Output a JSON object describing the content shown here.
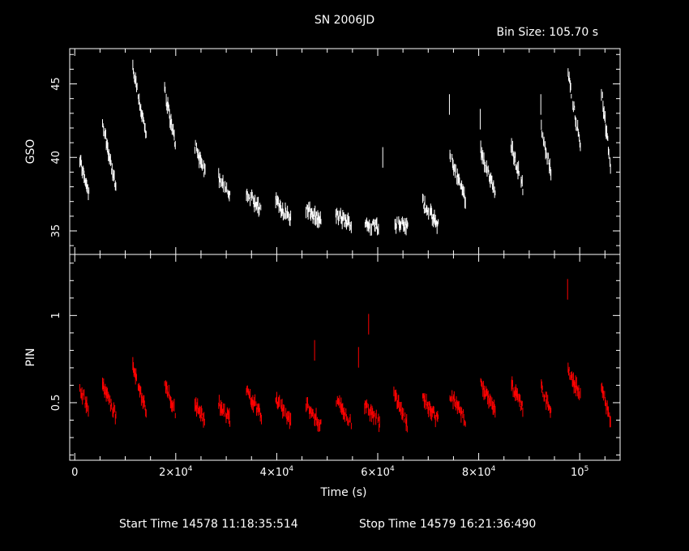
{
  "header": {
    "title": "SN 2006JD",
    "bin_size": "Bin Size: 105.70 s"
  },
  "footer": {
    "start_time": "Start Time 14578 11:18:35:514",
    "stop_time": "Stop Time 14579 16:21:36:490"
  },
  "colors": {
    "background": "#000000",
    "axes": "#ffffff",
    "gso_series": "#ffffff",
    "pin_series": "#ff0000"
  },
  "chart_data": [
    {
      "type": "scatter",
      "panel": "top",
      "ylabel": "GSO",
      "xlim": [
        -1000,
        108000
      ],
      "ylim": [
        33.4,
        47.4
      ],
      "yticks": [
        35,
        40,
        45
      ],
      "ytick_labels": [
        "35",
        "40",
        "45"
      ],
      "series": [
        {
          "segments": [
            {
              "x": [
                1000,
                2800
              ],
              "y": [
                39.8,
                37.6
              ]
            },
            {
              "x": [
                5500,
                8200
              ],
              "y": [
                42.4,
                37.8
              ]
            },
            {
              "x": [
                11500,
                14200
              ],
              "y": [
                46.0,
                41.4
              ]
            },
            {
              "x": [
                17800,
                20000
              ],
              "y": [
                44.5,
                40.8
              ]
            },
            {
              "x": [
                23800,
                25900
              ],
              "y": [
                40.8,
                38.9
              ]
            },
            {
              "x": [
                28500,
                30800
              ],
              "y": [
                38.6,
                37.6
              ]
            },
            {
              "x": [
                34000,
                37000
              ],
              "y": [
                37.6,
                36.3
              ]
            },
            {
              "x": [
                39800,
                42800
              ],
              "y": [
                37.1,
                35.8
              ]
            },
            {
              "x": [
                45800,
                48800
              ],
              "y": [
                36.5,
                35.6
              ]
            },
            {
              "x": [
                51700,
                54800
              ],
              "y": [
                36.1,
                35.4
              ]
            },
            {
              "x": [
                57400,
                60400
              ],
              "y": [
                35.5,
                35.3
              ]
            },
            {
              "x": [
                63200,
                66000
              ],
              "y": [
                35.5,
                35.3
              ]
            },
            {
              "x": [
                68900,
                72000
              ],
              "y": [
                37.0,
                35.3
              ]
            },
            {
              "x": [
                74300,
                77400
              ],
              "y": [
                40.1,
                37.2
              ]
            },
            {
              "x": [
                80400,
                83300
              ],
              "y": [
                40.5,
                37.5
              ]
            },
            {
              "x": [
                86400,
                88800
              ],
              "y": [
                40.8,
                37.9
              ]
            },
            {
              "x": [
                92400,
                94400
              ],
              "y": [
                41.9,
                38.8
              ]
            },
            {
              "x": [
                97700,
                100200
              ],
              "y": [
                45.6,
                40.8
              ]
            },
            {
              "x": [
                104300,
                106100
              ],
              "y": [
                44.5,
                39.5
              ]
            }
          ],
          "outliers": [
            {
              "x": 61000,
              "y": 40.0
            },
            {
              "x": 74200,
              "y": 43.6
            },
            {
              "x": 80300,
              "y": 42.6
            },
            {
              "x": 92300,
              "y": 43.6
            }
          ]
        }
      ]
    },
    {
      "type": "scatter",
      "panel": "bottom",
      "ylabel": "PIN",
      "xlabel": "Time (s)",
      "xlim": [
        -1000,
        108000
      ],
      "ylim": [
        0.17,
        1.35
      ],
      "yticks": [
        0.5,
        1
      ],
      "ytick_labels": [
        "0.5",
        "1"
      ],
      "xticks": [
        0,
        20000,
        40000,
        60000,
        80000,
        100000
      ],
      "xtick_labels": [
        {
          "base": "0",
          "exp": ""
        },
        {
          "base": "2×10",
          "exp": "4"
        },
        {
          "base": "4×10",
          "exp": "4"
        },
        {
          "base": "6×10",
          "exp": "4"
        },
        {
          "base": "8×10",
          "exp": "4"
        },
        {
          "base": "10",
          "exp": "5"
        }
      ],
      "series": [
        {
          "segments": [
            {
              "x": [
                1000,
                2800
              ],
              "y": [
                0.58,
                0.46
              ]
            },
            {
              "x": [
                5500,
                8200
              ],
              "y": [
                0.6,
                0.42
              ]
            },
            {
              "x": [
                11500,
                14200
              ],
              "y": [
                0.7,
                0.45
              ]
            },
            {
              "x": [
                17800,
                20000
              ],
              "y": [
                0.62,
                0.44
              ]
            },
            {
              "x": [
                23800,
                25900
              ],
              "y": [
                0.5,
                0.38
              ]
            },
            {
              "x": [
                28500,
                30800
              ],
              "y": [
                0.5,
                0.4
              ]
            },
            {
              "x": [
                34000,
                37000
              ],
              "y": [
                0.57,
                0.43
              ]
            },
            {
              "x": [
                39800,
                42800
              ],
              "y": [
                0.52,
                0.38
              ]
            },
            {
              "x": [
                45800,
                48800
              ],
              "y": [
                0.5,
                0.36
              ]
            },
            {
              "x": [
                51700,
                54800
              ],
              "y": [
                0.52,
                0.38
              ]
            },
            {
              "x": [
                57400,
                60400
              ],
              "y": [
                0.49,
                0.38
              ]
            },
            {
              "x": [
                63200,
                66000
              ],
              "y": [
                0.56,
                0.36
              ]
            },
            {
              "x": [
                68900,
                72000
              ],
              "y": [
                0.52,
                0.4
              ]
            },
            {
              "x": [
                74300,
                77400
              ],
              "y": [
                0.55,
                0.4
              ]
            },
            {
              "x": [
                80400,
                83300
              ],
              "y": [
                0.6,
                0.46
              ]
            },
            {
              "x": [
                86400,
                88800
              ],
              "y": [
                0.6,
                0.46
              ]
            },
            {
              "x": [
                92400,
                94400
              ],
              "y": [
                0.58,
                0.44
              ]
            },
            {
              "x": [
                97700,
                100200
              ],
              "y": [
                0.68,
                0.54
              ]
            },
            {
              "x": [
                104300,
                106100
              ],
              "y": [
                0.6,
                0.38
              ]
            }
          ],
          "outliers": [
            {
              "x": 47500,
              "y": 0.8
            },
            {
              "x": 56200,
              "y": 0.76
            },
            {
              "x": 58200,
              "y": 0.95
            },
            {
              "x": 97600,
              "y": 1.15
            }
          ]
        }
      ]
    }
  ]
}
